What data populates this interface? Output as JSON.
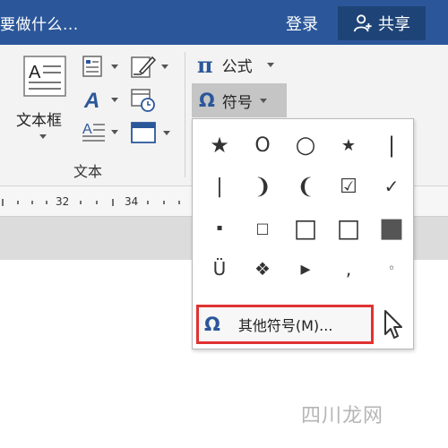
{
  "titlebar": {
    "tell_me": "要做什么...",
    "login": "登录",
    "share": "共享"
  },
  "ribbon": {
    "textbox_label": "文本框",
    "group_label": "文本",
    "formula_label": "公式",
    "symbol_label": "符号"
  },
  "ruler": {
    "numbers": [
      "32",
      "34"
    ]
  },
  "symbols": {
    "grid": [
      [
        "★",
        "O",
        "○",
        "★",
        "|"
      ],
      [
        "|",
        "❩",
        "❨",
        "☑",
        "✓"
      ],
      [
        "▪",
        "□",
        "□",
        "□",
        "■"
      ],
      [
        "Ü",
        "❖",
        "▸",
        ",",
        "◦"
      ]
    ],
    "more_label": "其他符号(M)..."
  },
  "watermark": "四川龙网"
}
